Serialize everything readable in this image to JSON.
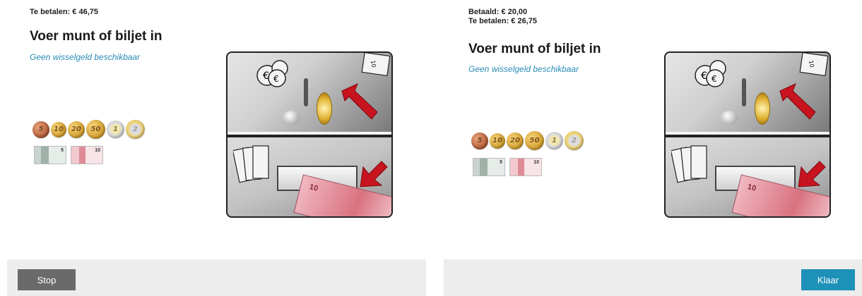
{
  "left": {
    "status": "Te betalen: € 46,75",
    "title": "Voer munt of biljet in",
    "subtitle": "Geen wisselgeld beschikbaar",
    "coins": [
      "5c",
      "10c",
      "20c",
      "50c",
      "1€",
      "2€"
    ],
    "notes": [
      "5",
      "10"
    ],
    "button": "Stop"
  },
  "right": {
    "status_line1": "Betaald: € 20,00",
    "status_line2": "Te betalen: € 26,75",
    "title": "Voer munt of biljet in",
    "subtitle": "Geen wisselgeld beschikbaar",
    "coins": [
      "5c",
      "10c",
      "20c",
      "50c",
      "1€",
      "2€"
    ],
    "notes": [
      "5",
      "10"
    ],
    "button": "Klaar"
  },
  "colors": {
    "accent": "#2a8bb5",
    "primary_button": "#1e91b8",
    "stop_button": "#6a6a6a",
    "footer_bg": "#ededed"
  },
  "icons": [
    "coin-slot-illustration",
    "banknote-slot-illustration",
    "red-arrow-icon"
  ]
}
